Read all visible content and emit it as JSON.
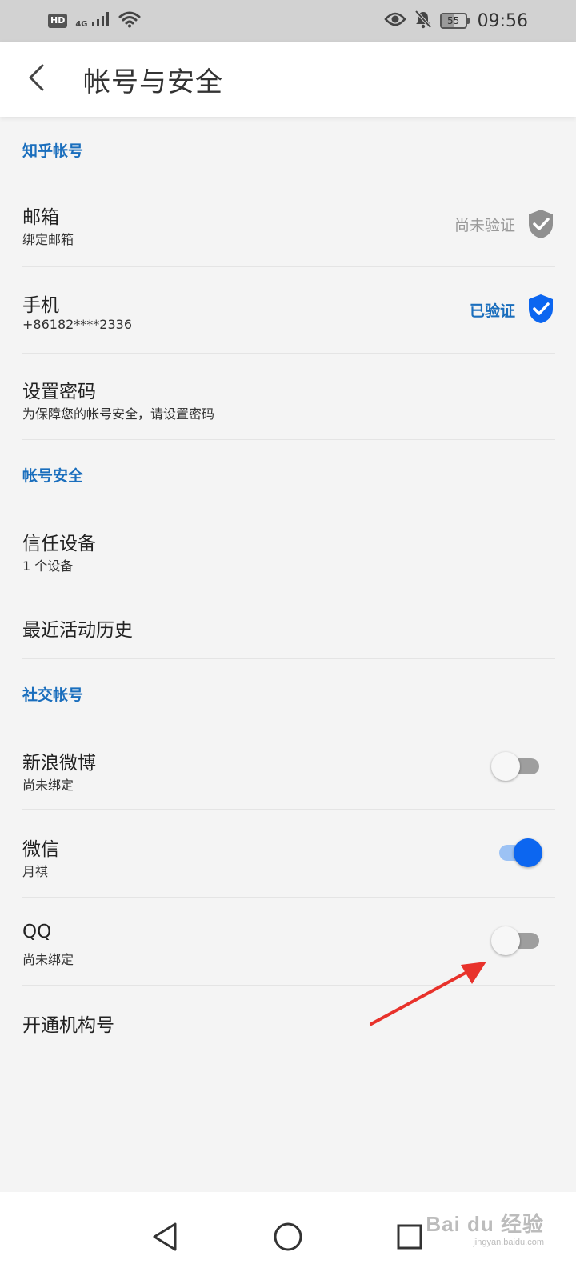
{
  "status_bar": {
    "hd": "HD",
    "network": "4G",
    "battery": "55",
    "battery_level": 0.55,
    "time": "09:56",
    "icons": [
      "signal-icon",
      "wifi-icon",
      "eye-icon",
      "bell-off-icon",
      "battery-icon"
    ]
  },
  "header": {
    "title": "帐号与安全",
    "back_icon": "chevron-left-icon"
  },
  "sections": {
    "zhihu_account": {
      "title": "知乎帐号",
      "email": {
        "title": "邮箱",
        "subtitle": "绑定邮箱",
        "status": "尚未验证"
      },
      "phone": {
        "title": "手机",
        "subtitle": "+86182****2336",
        "status": "已验证"
      },
      "password": {
        "title": "设置密码",
        "subtitle": "为保障您的帐号安全，请设置密码"
      }
    },
    "account_security": {
      "title": "帐号安全",
      "trusted_devices": {
        "title": "信任设备",
        "subtitle": "1 个设备"
      },
      "recent_activity": {
        "title": "最近活动历史"
      }
    },
    "social_accounts": {
      "title": "社交帐号",
      "weibo": {
        "title": "新浪微博",
        "subtitle": "尚未绑定",
        "enabled": false
      },
      "wechat": {
        "title": "微信",
        "subtitle": "月祺",
        "enabled": true
      },
      "qq": {
        "title": "QQ",
        "subtitle": "尚未绑定",
        "enabled": false
      },
      "org": {
        "title": "开通机构号"
      }
    }
  },
  "colors": {
    "accent": "#1a6ebd",
    "toggle_on": "#0c66f0",
    "arrow": "#e8322b"
  },
  "nav_bar": {
    "icons": [
      "back-triangle-icon",
      "home-circle-icon",
      "recents-square-icon"
    ]
  },
  "watermark": {
    "main": "Bai du 经验",
    "sub": "jingyan.baidu.com"
  }
}
